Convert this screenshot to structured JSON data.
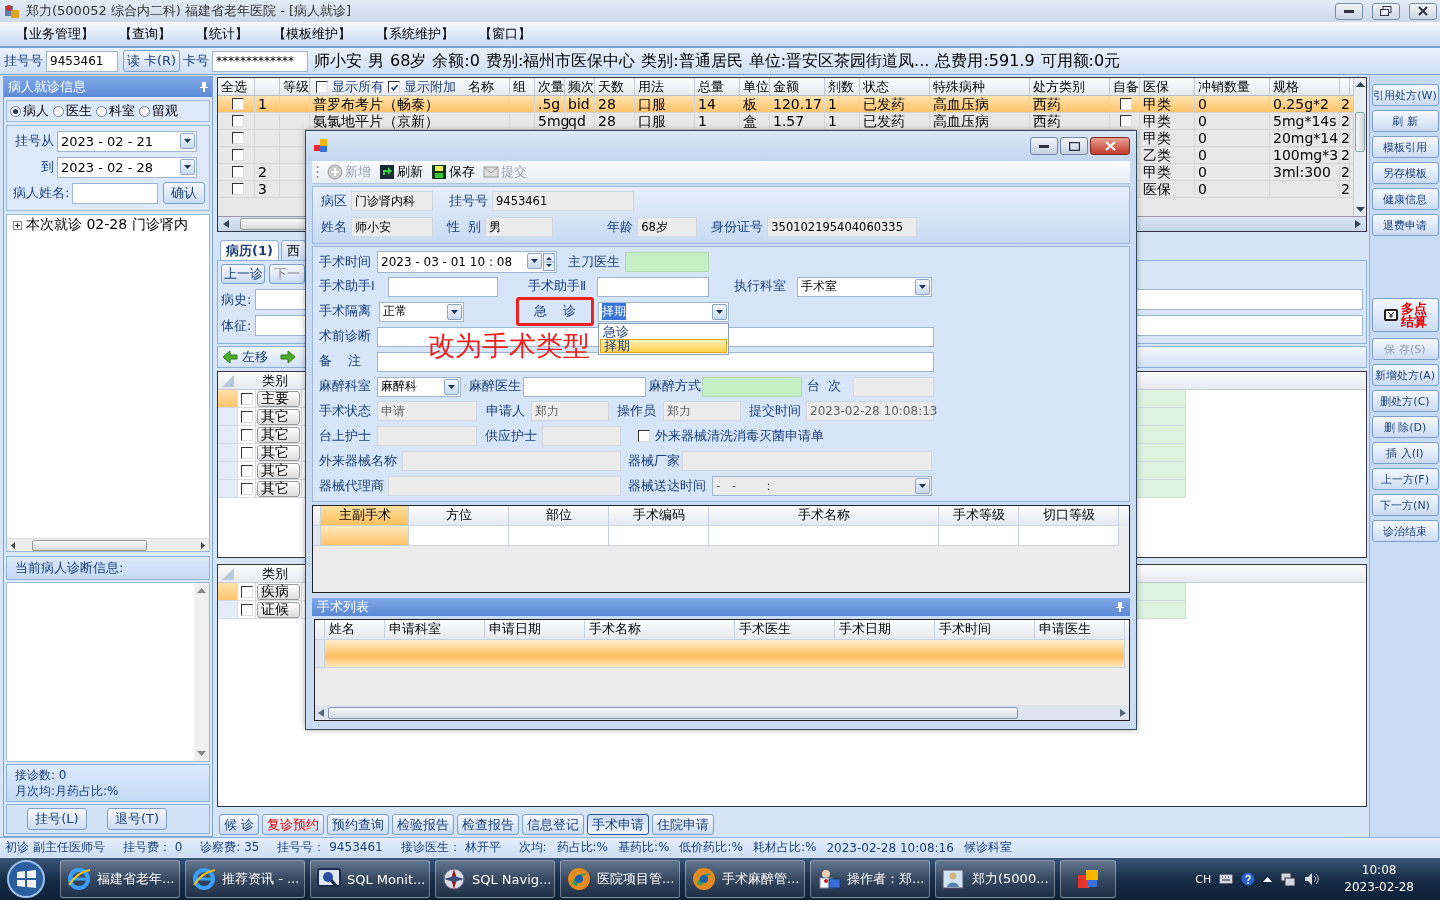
{
  "window": {
    "title": "郑力(500052 综合内二科) 福建省老年医院 - [病人就诊]"
  },
  "menu": [
    "【业务管理】",
    "【查询】",
    "【统计】",
    "【模板维护】",
    "【系统维护】",
    "【窗口】"
  ],
  "patient_bar": {
    "reg_label": "挂号号",
    "reg_no": "9453461",
    "read_card": "读 卡(R)",
    "card_label": "卡号",
    "card_no": "*************",
    "info": [
      "师小安",
      "男",
      "68岁",
      "余额:0",
      "费别:福州市医保中心",
      "类别:普通居民",
      "单位:晋安区茶园街道凤...",
      "总费用:591.9",
      "可用额:0元"
    ]
  },
  "left_panel": {
    "title": "病人就诊信息",
    "radios": [
      {
        "label": "病人",
        "selected": true
      },
      {
        "label": "医生",
        "selected": false
      },
      {
        "label": "科室",
        "selected": false
      },
      {
        "label": "留观",
        "selected": false
      }
    ],
    "from_label": "挂号从",
    "from_date": "2023 - 02 - 21",
    "to_label": "到",
    "to_date": "2023 - 02 - 28",
    "name_label": "病人姓名:",
    "confirm": "确认",
    "tree": [
      {
        "label": "本次就诊  02-28  门诊肾内",
        "expanded": false
      }
    ],
    "diagnosis_title": "当前病人诊断信息:",
    "visits": "接诊数: 0",
    "ratio": "月次均:月药占比:%",
    "buttons": [
      "挂号(L)",
      "退号(T)"
    ]
  },
  "prescription_grid": {
    "columns": [
      "全选",
      null,
      "等级",
      "名称",
      "组",
      "次量",
      "频次",
      "天数",
      "用法",
      "总量",
      "单位",
      "金额",
      "剂数",
      "状态",
      "特殊病种",
      "处方类别",
      "自备",
      "医保",
      "冲销数量",
      "规格",
      null
    ],
    "show_all": {
      "label": "显示所有",
      "checked": false
    },
    "show_extra": {
      "label": "显示附加",
      "checked": true
    },
    "rows": [
      {
        "selected": true,
        "cells": [
          {
            "kind": "checkbox",
            "checked": false
          },
          "1",
          null,
          "普罗布考片（畅泰）",
          null,
          ".5g",
          "bid",
          "28",
          "口服",
          "14",
          "板",
          "120.17",
          "1",
          "已发药",
          "高血压病",
          "西药",
          {
            "kind": "checkbox",
            "checked": false
          },
          "甲类",
          "0",
          "0.25g*2",
          "2"
        ]
      },
      {
        "selected": false,
        "cells": [
          {
            "kind": "checkbox",
            "checked": false
          },
          null,
          null,
          "氨氯地平片（京新）",
          null,
          "5mg",
          "qd",
          "28",
          "口服",
          "1",
          "盒",
          "1.57",
          "1",
          "已发药",
          "高血压病",
          "西药",
          {
            "kind": "checkbox",
            "checked": false
          },
          "甲类",
          "0",
          "5mg*14s",
          "2"
        ]
      },
      {
        "selected": false,
        "cells": [
          {
            "kind": "checkbox",
            "checked": false
          },
          null,
          null,
          null,
          null,
          null,
          null,
          null,
          null,
          null,
          null,
          null,
          null,
          null,
          null,
          null,
          null,
          "甲类",
          "0",
          "20mg*14",
          "2"
        ]
      },
      {
        "selected": false,
        "cells": [
          {
            "kind": "checkbox",
            "checked": false
          },
          null,
          null,
          null,
          null,
          null,
          null,
          null,
          null,
          null,
          null,
          null,
          null,
          null,
          null,
          null,
          null,
          "乙类",
          "0",
          "100mg*3",
          "2"
        ]
      },
      {
        "selected": false,
        "cells": [
          {
            "kind": "checkbox",
            "checked": false
          },
          "2",
          null,
          null,
          null,
          null,
          null,
          null,
          null,
          null,
          null,
          null,
          null,
          null,
          null,
          null,
          null,
          "甲类",
          "0",
          "3ml:300",
          "2"
        ]
      },
      {
        "selected": false,
        "cells": [
          {
            "kind": "checkbox",
            "checked": false
          },
          "3",
          null,
          null,
          null,
          null,
          null,
          null,
          null,
          null,
          null,
          null,
          null,
          null,
          null,
          null,
          null,
          "医保",
          "0",
          null,
          "2"
        ]
      }
    ]
  },
  "tabs": [
    {
      "label": "病历(1)",
      "selected": true
    },
    {
      "label": "西",
      "selected": false
    }
  ],
  "record": {
    "prev": "上一诊",
    "next": "下一",
    "history": "病史:",
    "signs": "体征:",
    "move_left": "左移"
  },
  "diagnosis_grids": [
    {
      "column": "类别",
      "rows": [
        {
          "label": "主要",
          "selected": true,
          "checked": false
        },
        {
          "label": "其它",
          "selected": false,
          "checked": false
        },
        {
          "label": "其它",
          "selected": false,
          "checked": false
        },
        {
          "label": "其它",
          "selected": false,
          "checked": false
        },
        {
          "label": "其它",
          "selected": false,
          "checked": false
        },
        {
          "label": "其它",
          "selected": false,
          "checked": false
        }
      ]
    },
    {
      "column": "类别",
      "rows": [
        {
          "label": "疾病",
          "selected": true,
          "checked": false
        },
        {
          "label": "证候",
          "selected": false,
          "checked": false
        }
      ]
    }
  ],
  "bottom_buttons": [
    {
      "label": "候 诊",
      "kind": "normal",
      "selected": false
    },
    {
      "label": "复诊预约",
      "kind": "warn",
      "selected": false
    },
    {
      "label": "预约查询",
      "kind": "normal",
      "selected": false
    },
    {
      "label": "检验报告",
      "kind": "normal",
      "selected": false
    },
    {
      "label": "检查报告",
      "kind": "normal",
      "selected": false
    },
    {
      "label": "信息登记",
      "kind": "normal",
      "selected": false
    },
    {
      "label": "手术申请",
      "kind": "normal",
      "selected": true
    },
    {
      "label": "住院申请",
      "kind": "normal",
      "selected": false
    }
  ],
  "side_buttons": [
    {
      "label": "引用处方(W)",
      "kind": "button",
      "disabled": false
    },
    {
      "label": "刷 新",
      "kind": "button",
      "disabled": false
    },
    {
      "label": "模板引用",
      "kind": "button",
      "disabled": false
    },
    {
      "label": "另存模板",
      "kind": "button",
      "disabled": false
    },
    {
      "label": "健康信息",
      "kind": "button",
      "disabled": false
    },
    {
      "label": "退费申请",
      "kind": "button",
      "disabled": false
    },
    {
      "label": "多点结算",
      "kind": "settle",
      "disabled": false
    },
    {
      "label": "保 存(S)",
      "kind": "button",
      "disabled": true
    },
    {
      "label": "新增处方(A)",
      "kind": "button",
      "disabled": false
    },
    {
      "label": "删处方(C)",
      "kind": "button",
      "disabled": false
    },
    {
      "label": "删 除(D)",
      "kind": "button",
      "disabled": false
    },
    {
      "label": "插 入(I)",
      "kind": "button",
      "disabled": false
    },
    {
      "label": "上一方(F)",
      "kind": "button",
      "disabled": false
    },
    {
      "label": "下一方(N)",
      "kind": "button",
      "disabled": false
    },
    {
      "label": "诊治结束",
      "kind": "button",
      "disabled": false
    }
  ],
  "status_bar": [
    "初诊 副主任医师号",
    "挂号费： 0",
    "诊察费: 35",
    "挂号号： 9453461",
    "接诊医生： 林开平",
    "次均:",
    "药占比:%",
    "基药比:%",
    "低价药比:%",
    "耗材占比:%",
    "2023-02-28 10:08:16",
    "候诊科室"
  ],
  "dialog": {
    "toolbar": [
      {
        "label": "新增",
        "kind": "add",
        "disabled": true
      },
      {
        "label": "刷新",
        "kind": "refresh",
        "disabled": false
      },
      {
        "label": "保存",
        "kind": "save",
        "disabled": false
      },
      {
        "label": "提交",
        "kind": "submit",
        "disabled": true
      }
    ],
    "info": [
      {
        "label": "病区",
        "value": "门诊肾内科"
      },
      {
        "label": "挂号号",
        "value": "9453461"
      },
      {
        "label": "姓名",
        "value": "师小安"
      },
      {
        "label": "性  别",
        "value": "男"
      },
      {
        "label": "年龄",
        "value": "68岁"
      },
      {
        "label": "身份证号",
        "value": "350102195404060335"
      }
    ],
    "form": [
      [
        {
          "kind": "label",
          "text": "手术时间"
        },
        {
          "kind": "datetime",
          "value": "2023 - 03 - 01   10 : 08"
        },
        {
          "kind": "label",
          "text": "主刀医生"
        },
        {
          "kind": "required_field"
        }
      ],
      [
        {
          "kind": "label",
          "text": "手术助手Ⅰ"
        },
        {
          "kind": "field"
        },
        {
          "kind": "label",
          "text": "手术助手Ⅱ"
        },
        {
          "kind": "field"
        },
        {
          "kind": "label",
          "text": "执行科室"
        },
        {
          "kind": "combo",
          "value": "手术室",
          "open": false
        }
      ],
      [
        {
          "kind": "label",
          "text": "手术隔离"
        },
        {
          "kind": "combo",
          "value": "正常",
          "open": false
        },
        {
          "kind": "boxed_label",
          "text": "急    诊"
        },
        {
          "kind": "combo",
          "value": "择期",
          "open": true,
          "options": [
            {
              "label": "急诊",
              "selected": false
            },
            {
              "label": "择期",
              "selected": true
            }
          ]
        }
      ],
      [
        {
          "kind": "label",
          "text": "术前诊断"
        },
        {
          "kind": "field"
        }
      ],
      [
        {
          "kind": "label",
          "text": "备    注"
        },
        {
          "kind": "field"
        }
      ],
      [
        {
          "kind": "label",
          "text": "麻醉科室"
        },
        {
          "kind": "combo",
          "value": "麻醉科",
          "open": false
        },
        {
          "kind": "label",
          "text": "麻醉医生"
        },
        {
          "kind": "field"
        },
        {
          "kind": "label",
          "text": "麻醉方式"
        },
        {
          "kind": "required_field"
        },
        {
          "kind": "label",
          "text": "台  次"
        },
        {
          "kind": "readonly_field"
        }
      ],
      [
        {
          "kind": "label",
          "text": "手术状态"
        },
        {
          "kind": "readonly_field",
          "value": "申请"
        },
        {
          "kind": "label",
          "text": "申请人"
        },
        {
          "kind": "readonly_field",
          "value": "郑力"
        },
        {
          "kind": "label",
          "text": "操作员"
        },
        {
          "kind": "readonly_field",
          "value": "郑力"
        },
        {
          "kind": "label",
          "text": "提交时间"
        },
        {
          "kind": "readonly_field",
          "value": "2023-02-28 10:08:13"
        }
      ],
      [
        {
          "kind": "label",
          "text": "台上护士"
        },
        {
          "kind": "readonly_field"
        },
        {
          "kind": "label",
          "text": "供应护士"
        },
        {
          "kind": "readonly_field"
        },
        {
          "kind": "check",
          "text": "外来器械清洗消毒灭菌申请单",
          "checked": false
        }
      ],
      [
        {
          "kind": "label",
          "text": "外来器械名称"
        },
        {
          "kind": "readonly_field"
        },
        {
          "kind": "label",
          "text": "器械厂家"
        },
        {
          "kind": "readonly_field"
        }
      ],
      [
        {
          "kind": "label",
          "text": "器械代理商"
        },
        {
          "kind": "readonly_field"
        },
        {
          "kind": "label",
          "text": "器械送达时间"
        },
        {
          "kind": "readonly_combo",
          "value": "-   -        :"
        }
      ]
    ],
    "annotation": "改为手术类型",
    "surgery_grid": {
      "columns": [
        "主副手术",
        "方位",
        "部位",
        "手术编码",
        "手术名称",
        "手术等级",
        "切口等级"
      ],
      "rows": [
        {
          "selected": true
        }
      ]
    },
    "surgery_list": {
      "title": "手术列表",
      "columns": [
        "姓名",
        "申请科室",
        "申请日期",
        "手术名称",
        "手术医生",
        "手术日期",
        "手术时间",
        "申请医生"
      ],
      "rows": [
        {
          "selected": true
        }
      ]
    }
  },
  "taskbar": {
    "items": [
      {
        "label": "福建省老年...",
        "kind": "browser"
      },
      {
        "label": "推荐资讯 - ...",
        "kind": "browser"
      },
      {
        "label": "SQL Monit...",
        "kind": "monitor"
      },
      {
        "label": "SQL Navig...",
        "kind": "compass"
      },
      {
        "label": "医院项目管...",
        "kind": "swirl"
      },
      {
        "label": "手术麻醉管...",
        "kind": "swirl"
      },
      {
        "label": "操作者：郑...",
        "kind": "doctor"
      },
      {
        "label": "郑力(5000...",
        "kind": "app"
      },
      {
        "kind": "tiles"
      }
    ],
    "lang": "CH",
    "time": "10:08",
    "date": "2023-02-28"
  }
}
